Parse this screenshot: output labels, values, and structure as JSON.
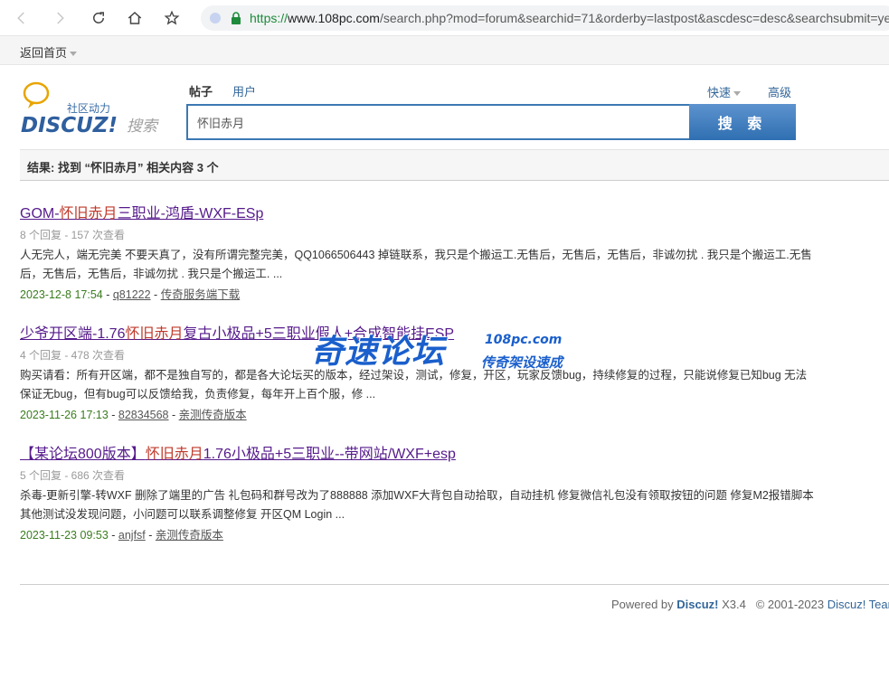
{
  "browser": {
    "url_protocol": "https://",
    "url_host": "www.108pc.com",
    "url_path": "/search.php?mod=forum&searchid=71&orderby=lastpost&ascdesc=desc&searchsubmit=yes"
  },
  "topbar": {
    "back_home": "返回首页"
  },
  "search": {
    "tab_posts": "帖子",
    "tab_users": "用户",
    "quick": "快速",
    "advanced": "高级",
    "query": "怀旧赤月",
    "button": "搜 索"
  },
  "logo": {
    "tagline": "社区动力",
    "brand": "DISCUZ!",
    "suffix": "搜索"
  },
  "result_summary": "结果: 找到 “怀旧赤月” 相关内容 3 个",
  "results": [
    {
      "title_pre": "GOM-",
      "title_hl": "怀旧赤月",
      "title_post": "三职业-鸿盾-WXF-ESp",
      "meta": "8 个回复 - 157 次查看",
      "snippet": "人无完人，端无完美 不要天真了，没有所谓完整完美，QQ1066506443 掉链联系，我只是个搬运工.无售后，无售后，无售后，非诚勿扰 . 我只是个搬运工.无售后，无售后，无售后，非诚勿扰 . 我只是个搬运工. ...",
      "date": "2023-12-8 17:54",
      "author": "q81222",
      "forum": "传奇服务端下载"
    },
    {
      "title_pre": "少爷开区端-1.76",
      "title_hl": "怀旧赤月",
      "title_post": "复古小极品+5三职业假人+合成智能挂ESP",
      "meta": "4 个回复 - 478 次查看",
      "snippet": "购买请看：所有开区端，都不是独自写的，都是各大论坛买的版本，经过架设，测试，修复，开区，玩家反馈bug，持续修复的过程，只能说修复已知bug 无法保证无bug，但有bug可以反馈给我，负责修复，每年开上百个服，修 ...",
      "date": "2023-11-26 17:13",
      "author": "82834568",
      "forum": "亲测传奇版本"
    },
    {
      "title_pre": "【某论坛800版本】",
      "title_hl": "怀旧赤月",
      "title_post": "1.76小极品+5三职业--带网站/WXF+esp",
      "meta": "5 个回复 - 686 次查看",
      "snippet": "杀毒-更新引擎-转WXF 删除了端里的广告 礼包码和群号改为了888888 添加WXF大背包自动拾取，自动挂机 修复微信礼包没有领取按钮的问题 修复M2报错脚本 其他测试没发现问题，小问题可以联系调整修复 开区QM Login ...",
      "date": "2023-11-23 09:53",
      "author": "anjfsf",
      "forum": "亲测传奇版本"
    }
  ],
  "watermark": {
    "main": "奇速论坛",
    "sub1": "108pc.com",
    "sub2": "传奇架设速成"
  },
  "footer": {
    "powered": "Powered by ",
    "brand": "Discuz!",
    "version": " X3.4",
    "copyright": "© 2001-2023 ",
    "brand2": "Discuz! Team."
  },
  "colors": {
    "link_visited": "#551a8b",
    "highlight": "#c0392b",
    "date_green": "#3a7d1f",
    "brand_blue": "#336699",
    "button_blue": "#2f6fb1"
  }
}
